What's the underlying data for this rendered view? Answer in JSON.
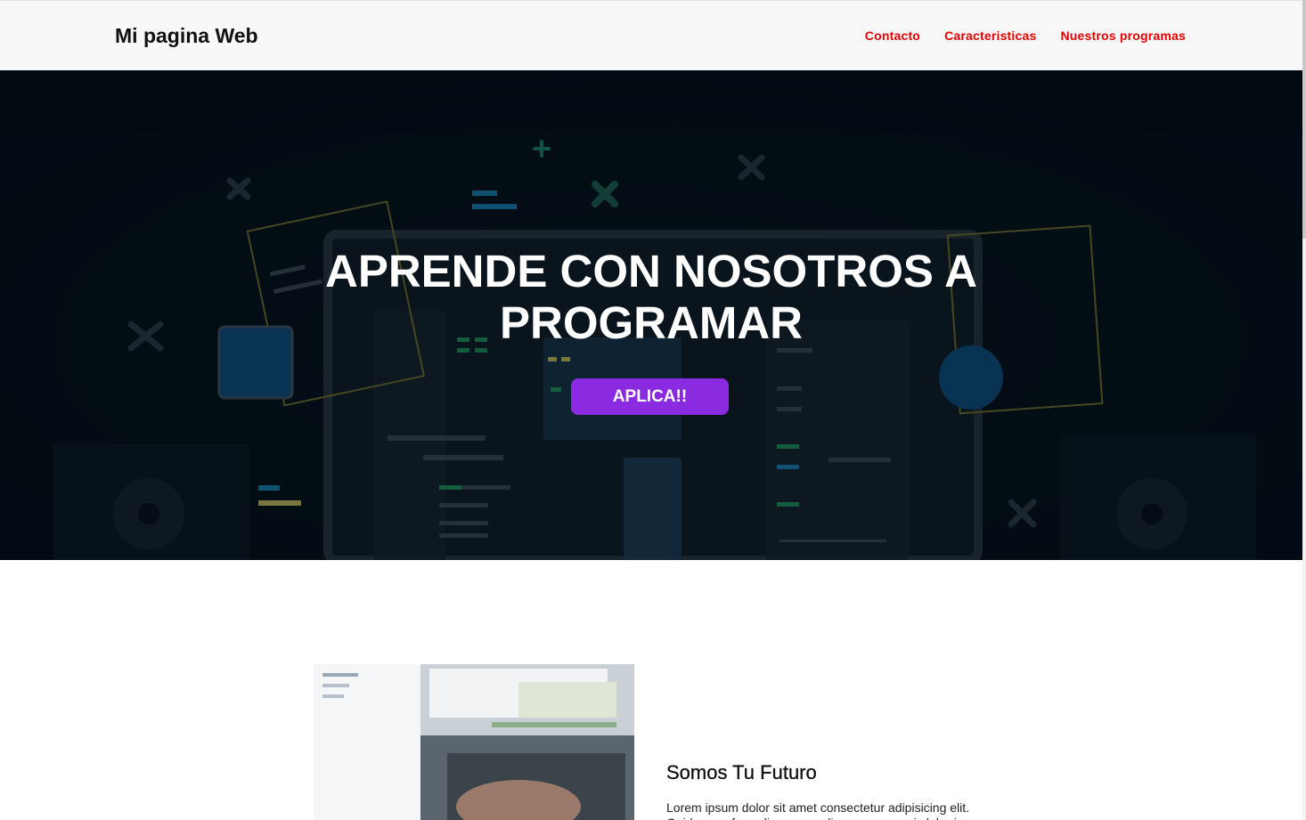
{
  "header": {
    "brand": "Mi pagina Web",
    "nav": [
      {
        "label": "Contacto"
      },
      {
        "label": "Caracteristicas"
      },
      {
        "label": "Nuestros programas"
      }
    ],
    "nav_color": "#e60000"
  },
  "hero": {
    "title_line1": "APRENDE CON NOSOTROS A",
    "title_line2": "PROGRAMAR",
    "cta_label": "APLICA!!",
    "cta_color": "#8a2be2"
  },
  "about": {
    "title": "Somos Tu Futuro",
    "text": "Lorem ipsum dolor sit amet consectetur adipisicing elit.",
    "text_2": "Quidem perferendis, commodi eaque, corporis laboriosam"
  }
}
